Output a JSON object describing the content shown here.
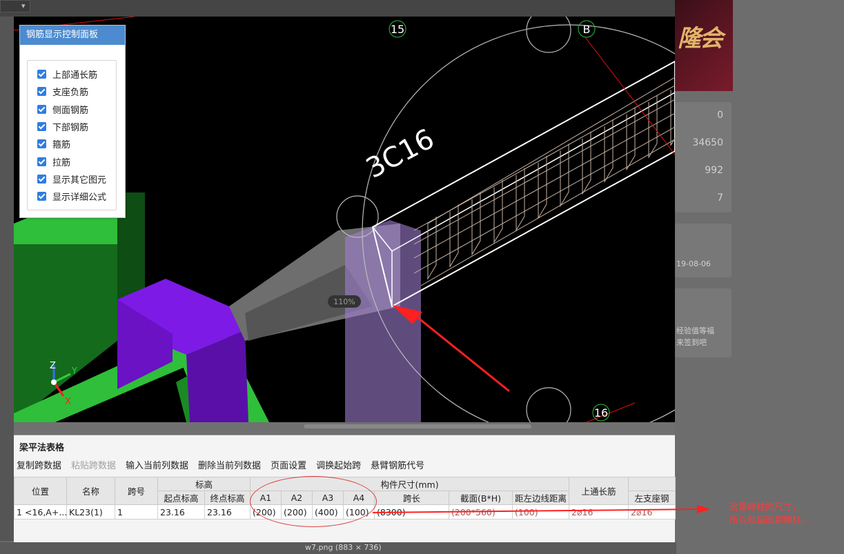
{
  "background": {
    "dropdown_symbol": "▾",
    "stats": [
      "0",
      "34650",
      "992",
      "7"
    ],
    "date_fragment": "19-08-06",
    "notice_line1": "经验值等福",
    "notice_line2": "来签到吧",
    "banner_text": "隆会",
    "footer_filename": "w7.png (883 × 736)"
  },
  "viewport": {
    "axis_labels": {
      "z": "Z",
      "y": "Y",
      "x": "X"
    },
    "grid_labels": {
      "top_left": "15",
      "top_right": "B",
      "bottom": "16"
    },
    "rebar_label": "3C16",
    "zoom": "110%"
  },
  "rebar_panel": {
    "title": "钢筋显示控制面板",
    "items": [
      {
        "label": "上部通长筋",
        "checked": true
      },
      {
        "label": "支座负筋",
        "checked": true
      },
      {
        "label": "侧面钢筋",
        "checked": true
      },
      {
        "label": "下部钢筋",
        "checked": true
      },
      {
        "label": "箍筋",
        "checked": true
      },
      {
        "label": "拉筋",
        "checked": true
      },
      {
        "label": "显示其它图元",
        "checked": true
      },
      {
        "label": "显示详细公式",
        "checked": true
      }
    ]
  },
  "table_panel": {
    "title": "梁平法表格",
    "toolbar": [
      {
        "label": "复制跨数据",
        "enabled": true
      },
      {
        "label": "粘贴跨数据",
        "enabled": false
      },
      {
        "label": "输入当前列数据",
        "enabled": true
      },
      {
        "label": "删除当前列数据",
        "enabled": true
      },
      {
        "label": "页面设置",
        "enabled": true
      },
      {
        "label": "调换起始跨",
        "enabled": true
      },
      {
        "label": "悬臂钢筋代号",
        "enabled": true
      }
    ],
    "headers": {
      "position": "位置",
      "name": "名称",
      "span_no": "跨号",
      "elevation": "标高",
      "elev_start": "起点标高",
      "elev_end": "终点标高",
      "dims": "构件尺寸(mm)",
      "a1": "A1",
      "a2": "A2",
      "a3": "A3",
      "a4": "A4",
      "span_len": "跨长",
      "section": "截面(B*H)",
      "edge_dist": "距左边线距离",
      "top_rebar": "上通长筋",
      "left_support": "左支座钢"
    },
    "rows": [
      {
        "idx": "1",
        "position": "<16,A+...",
        "name": "KL23(1)",
        "span_no": "1",
        "elev_start": "23.16",
        "elev_end": "23.16",
        "a1": "(200)",
        "a2": "(200)",
        "a3": "(400)",
        "a4": "(100)",
        "span_len": "(8300)",
        "section": "(200*560)",
        "edge_dist": "(100)",
        "top_rebar": "2⌀16",
        "left_support": "2⌀16"
      }
    ]
  },
  "annotation": {
    "line1": "这是暗柱的尺寸，",
    "line2": "所以就锚固到暗柱。"
  },
  "colors": {
    "beam_green": "#2fbf3a",
    "column_purple": "#7a16e0",
    "panel_blue": "#4c8bcf",
    "annotation_red": "#ff3b3b"
  }
}
